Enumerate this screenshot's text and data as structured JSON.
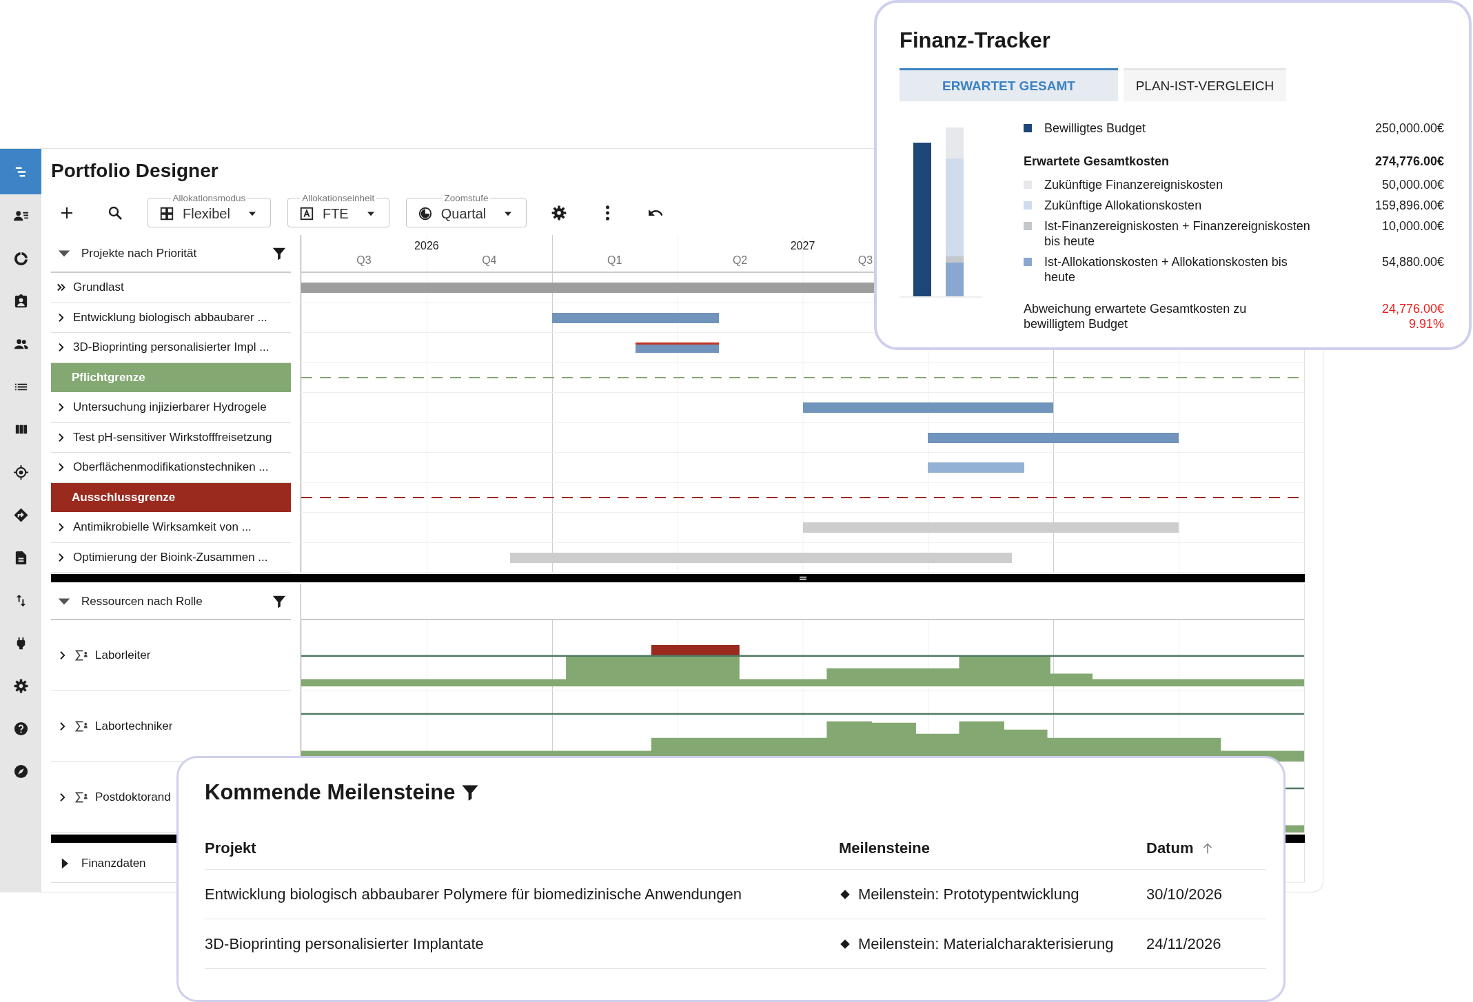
{
  "rail": [
    {
      "selected": true
    },
    {
      "selected": false
    },
    {
      "selected": false
    },
    {
      "selected": false
    },
    {
      "selected": false
    },
    {
      "selected": false
    },
    {
      "selected": false
    },
    {
      "selected": false
    },
    {
      "selected": false
    },
    {
      "selected": false
    },
    {
      "selected": false
    },
    {
      "selected": false
    },
    {
      "selected": false
    },
    {
      "selected": false
    },
    {
      "selected": false
    }
  ],
  "header": {
    "title": "Portfolio Designer"
  },
  "toolbar": {
    "dropdowns": [
      {
        "label": "Allokationsmodus",
        "value": "Flexibel"
      },
      {
        "label": "Allokationseinheit",
        "value": "FTE"
      },
      {
        "label": "Zoomstufe",
        "value": "Quartal"
      }
    ]
  },
  "timeline": {
    "years": [
      {
        "label": "2026",
        "quarters": [
          "Q3",
          "Q4"
        ]
      },
      {
        "label": "2027",
        "quarters": [
          "Q1",
          "Q2",
          "Q3"
        ]
      }
    ]
  },
  "projects": {
    "title": "Projekte nach Priorität",
    "expanded": true,
    "rows": [
      {
        "kind": "baseline",
        "label": "Grundlast",
        "bar": {
          "kind": "baseline",
          "delayed": false
        }
      },
      {
        "kind": "project",
        "label": "Entwicklung biologisch abbaubarer ...",
        "bar": {
          "kind": "planned",
          "delayed": false
        }
      },
      {
        "kind": "project",
        "label": "3D-Bioprinting personalisierter Impl ...",
        "bar": {
          "kind": "planned",
          "delayed": true
        }
      },
      {
        "kind": "threshold",
        "label": "Pflichtgrenze",
        "color": "#84a872"
      },
      {
        "kind": "project",
        "label": "Untersuchung injizierbarer Hydrogele",
        "bar": {
          "kind": "planned",
          "delayed": false
        }
      },
      {
        "kind": "project",
        "label": "Test pH-sensitiver Wirkstofffreisetzung",
        "bar": {
          "kind": "planned",
          "delayed": false
        }
      },
      {
        "kind": "project",
        "label": "Oberflächenmodifikationstechniken ...",
        "bar": {
          "kind": "tentative",
          "delayed": false
        }
      },
      {
        "kind": "threshold",
        "label": "Ausschlussgrenze",
        "color": "#9b2a1e"
      },
      {
        "kind": "project",
        "label": "Antimikrobielle Wirksamkeit von ...",
        "bar": {
          "kind": "excluded",
          "delayed": false
        }
      },
      {
        "kind": "project",
        "label": "Optimierung der Bioink-Zusammen ...",
        "bar": {
          "kind": "excluded",
          "delayed": false
        }
      }
    ]
  },
  "resources": {
    "title": "Ressourcen nach Rolle",
    "expanded": true,
    "rows": [
      {
        "label": "Laborleiter"
      },
      {
        "label": "Labortechniker"
      },
      {
        "label": "Postdoktorand"
      }
    ]
  },
  "finance_row": {
    "label": "Finanzdaten",
    "expanded": false
  },
  "finance_tracker": {
    "title": "Finanz-Tracker",
    "tabs": [
      {
        "label": "ERWARTET GESAMT",
        "selected": true
      },
      {
        "label": "PLAN-IST-VERGLEICH",
        "selected": false
      }
    ],
    "items": [
      {
        "kind": "budget",
        "label": "Bewilligtes Budget",
        "value": "250,000.00€",
        "color": "#1f4678"
      },
      {
        "kind": "total",
        "label": "Erwartete Gesamtkosten",
        "value": "274,776.00€"
      },
      {
        "kind": "component",
        "label": "Zukünftige Finanzereigniskosten",
        "value": "50,000.00€",
        "color": "#e6e8eb"
      },
      {
        "kind": "component",
        "label": "Zukünftige Allokationskosten",
        "value": "159,896.00€",
        "color": "#cfdcec"
      },
      {
        "kind": "component",
        "label": "Ist-Finanzereigniskosten + Finanzereigniskosten bis heute",
        "value": "10,000.00€",
        "color": "#c4c7cc"
      },
      {
        "kind": "component",
        "label": "Ist-Allokationskosten + Allokationskosten bis heute",
        "value": "54,880.00€",
        "color": "#8aa8cf"
      },
      {
        "kind": "deviation",
        "label": "Abweichung erwartete Gesamtkosten zu bewilligtem Budget",
        "value": "24,776.00€",
        "percent": "9.91%"
      }
    ]
  },
  "milestones": {
    "title": "Kommende Meilensteine",
    "columns": [
      {
        "label": "Projekt",
        "sorted": false
      },
      {
        "label": "Meilensteine",
        "sorted": false
      },
      {
        "label": "Datum",
        "sorted": true
      }
    ],
    "rows": [
      {
        "project": "Entwicklung biologisch abbaubarer Polymere für biomedizinische Anwendungen",
        "milestone": "Meilenstein: Prototypentwicklung",
        "date": "30/10/2026"
      },
      {
        "project": "3D-Bioprinting personalisierter Implantate",
        "milestone": "Meilenstein: Materialcharakterisierung",
        "date": "24/11/2026"
      }
    ]
  }
}
